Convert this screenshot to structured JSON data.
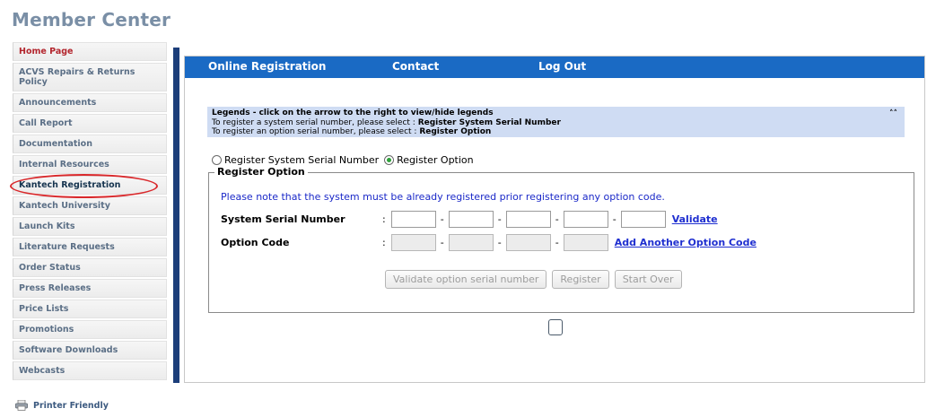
{
  "page": {
    "title": "Member Center"
  },
  "sidebar": {
    "items": [
      {
        "label": "Home Page"
      },
      {
        "label": "ACVS Repairs & Returns Policy"
      },
      {
        "label": "Announcements"
      },
      {
        "label": "Call Report"
      },
      {
        "label": "Documentation"
      },
      {
        "label": "Internal Resources"
      },
      {
        "label": "Kantech Registration"
      },
      {
        "label": "Kantech University"
      },
      {
        "label": "Launch Kits"
      },
      {
        "label": "Literature Requests"
      },
      {
        "label": "Order Status"
      },
      {
        "label": "Press Releases"
      },
      {
        "label": "Price Lists"
      },
      {
        "label": "Promotions"
      },
      {
        "label": "Software Downloads"
      },
      {
        "label": "Webcasts"
      }
    ],
    "printer_friendly": "Printer Friendly"
  },
  "nav": {
    "online_registration": "Online Registration",
    "contact": "Contact",
    "logout": "Log Out"
  },
  "legend": {
    "title": "Legends - click on the arrow to the right to view/hide legends",
    "line1_prefix": "To register a system serial number, please select :",
    "line1_bold": "Register System Serial Number",
    "line2_prefix": "To register an option serial number, please select :",
    "line2_bold": "Register Option",
    "toggle": "˄˄"
  },
  "mode": {
    "option1": "Register System Serial Number",
    "option2": "Register Option",
    "selected": "Register Option"
  },
  "form": {
    "legend": "Register Option",
    "notice": "Please note that the system must be already registered prior registering any option code.",
    "serial_label": "System Serial Number",
    "option_label": "Option Code",
    "colon": ":",
    "dash": "-",
    "validate": "Validate",
    "add_option": "Add Another Option Code"
  },
  "buttons": {
    "validate_option": "Validate option serial number",
    "register": "Register",
    "start_over": "Start Over"
  },
  "colors": {
    "nav_blue": "#1a6ac4",
    "divider_blue": "#1c3e7a",
    "highlight_red": "#d9282b"
  }
}
